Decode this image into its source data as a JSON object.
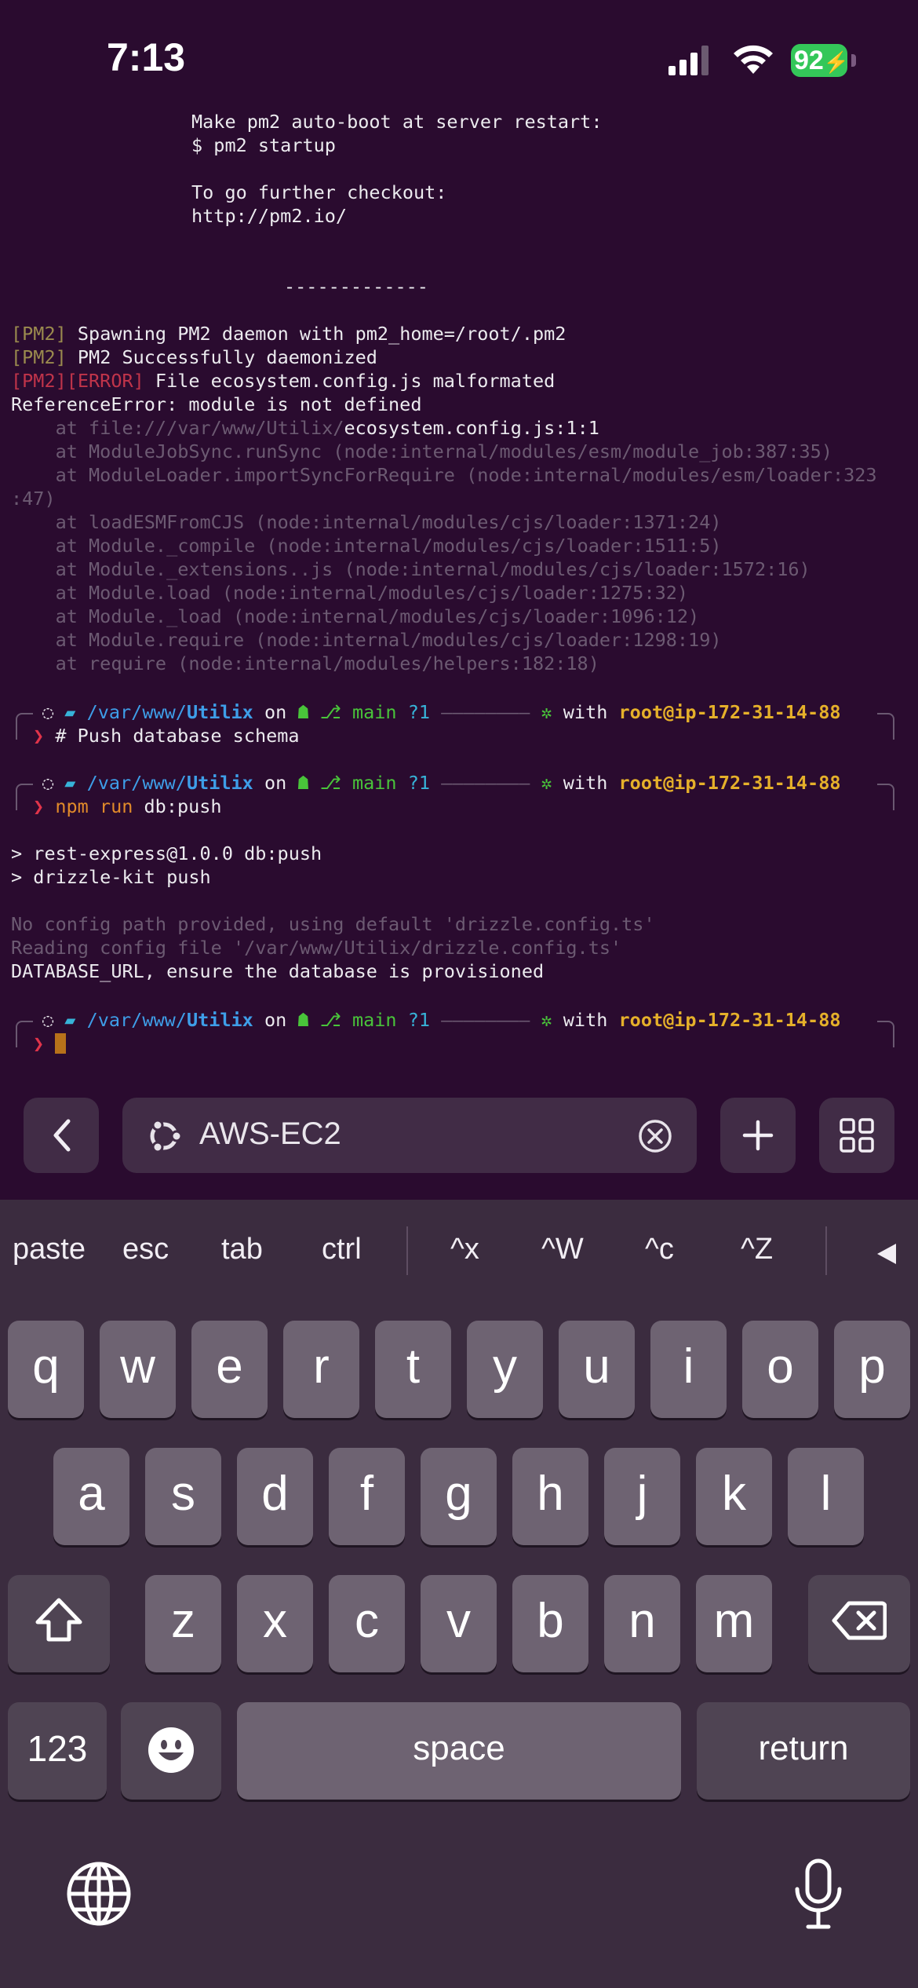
{
  "status_bar": {
    "time": "7:13",
    "battery": "92"
  },
  "terminal": {
    "intro": [
      "Make pm2 auto-boot at server restart:",
      "$ pm2 startup",
      "",
      "To go further checkout:",
      "http://pm2.io/"
    ],
    "separator": "-------------",
    "pm2_lines": [
      {
        "tag": "[PM2]",
        "text": " Spawning PM2 daemon with pm2_home=/root/.pm2"
      },
      {
        "tag": "[PM2]",
        "text": " PM2 Successfully daemonized"
      },
      {
        "tag": "[PM2][ERROR]",
        "text": " File ecosystem.config.js malformated"
      }
    ],
    "error_title": "ReferenceError: module is not defined",
    "trace_first": {
      "prefix": "    at ",
      "dim": "file:///var/www/Utilix/",
      "bright": "ecosystem.config.js:1:1"
    },
    "trace": [
      {
        "fn": "    at ModuleJobSync.runSync",
        "loc": " (node:internal/modules/esm/module_job:387:35)"
      },
      {
        "fn": "    at ModuleLoader.importSyncForRequire",
        "loc": " (node:internal/modules/esm/loader:323"
      },
      {
        "fn": ":47)",
        "loc": ""
      },
      {
        "fn": "    at loadESMFromCJS",
        "loc": " (node:internal/modules/cjs/loader:1371:24)"
      },
      {
        "fn": "    at Module._compile",
        "loc": " (node:internal/modules/cjs/loader:1511:5)"
      },
      {
        "fn": "    at Module._extensions..js",
        "loc": " (node:internal/modules/cjs/loader:1572:16)"
      },
      {
        "fn": "    at Module.load",
        "loc": " (node:internal/modules/cjs/loader:1275:32)"
      },
      {
        "fn": "    at Module._load",
        "loc": " (node:internal/modules/cjs/loader:1096:12)"
      },
      {
        "fn": "    at Module.require",
        "loc": " (node:internal/modules/cjs/loader:1298:19)"
      },
      {
        "fn": "    at require",
        "loc": " (node:internal/modules/helpers:182:18)"
      }
    ],
    "prompt": {
      "path_prefix": "/var/",
      "path_mid": "www/",
      "path_dir": "Utilix",
      "on": " on ",
      "branch": "main",
      "status": "?1",
      "dashes": "————————",
      "with": " with ",
      "user": "root@ip-172-31-14-88",
      "arrow": "❯"
    },
    "cmd1": "# Push database schema",
    "cmd2_npm": "npm",
    "cmd2_run": "run",
    "cmd2_rest": " db:push",
    "out1": "> rest-express@1.0.0 db:push",
    "out2": "> drizzle-kit push",
    "out3": "No config path provided, using default 'drizzle.config.ts'",
    "out4": "Reading config file '/var/www/Utilix/drizzle.config.ts'",
    "out5": "DATABASE_URL, ensure the database is provisioned"
  },
  "toolbar": {
    "host": "AWS-EC2"
  },
  "quickbar": {
    "keys": [
      "paste",
      "esc",
      "tab",
      "ctrl",
      "^x",
      "^W",
      "^c",
      "^Z"
    ]
  },
  "keyboard": {
    "row1": [
      "q",
      "w",
      "e",
      "r",
      "t",
      "y",
      "u",
      "i",
      "o",
      "p"
    ],
    "row2": [
      "a",
      "s",
      "d",
      "f",
      "g",
      "h",
      "j",
      "k",
      "l"
    ],
    "row3": [
      "z",
      "x",
      "c",
      "v",
      "b",
      "n",
      "m"
    ],
    "numbers": "123",
    "space": "space",
    "return": "return"
  },
  "colors": {
    "terminal_bg": "#2a0b2f",
    "user": "#e5b02a",
    "path": "#3e9ee8",
    "branch": "#49c43a"
  }
}
